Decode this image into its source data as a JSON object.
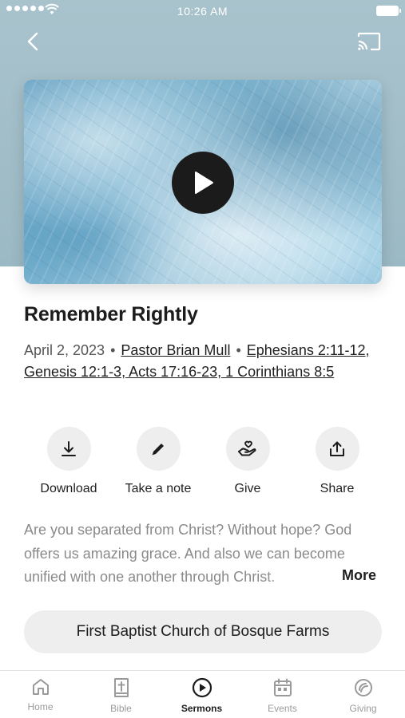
{
  "status_bar": {
    "time": "10:26 AM"
  },
  "sermon": {
    "title": "Remember Rightly",
    "date": "April 2, 2023",
    "speaker": "Pastor Brian Mull",
    "scripture": "Ephesians 2:11-12, Genesis 12:1-3, Acts 17:16-23, 1 Corinthians 8:5",
    "description": "Are you separated from Christ? Without hope? God offers us amazing grace. And also we can become unified with one another through Christ."
  },
  "actions": [
    {
      "label": "Download",
      "icon": "download-icon"
    },
    {
      "label": "Take a note",
      "icon": "pencil-icon"
    },
    {
      "label": "Give",
      "icon": "giving-hand-icon"
    },
    {
      "label": "Share",
      "icon": "share-icon"
    }
  ],
  "more_label": "More",
  "church_name": "First Baptist Church of Bosque Farms",
  "tabs": [
    {
      "label": "Home",
      "icon": "home-icon"
    },
    {
      "label": "Bible",
      "icon": "bible-icon"
    },
    {
      "label": "Sermons",
      "icon": "play-circle-icon"
    },
    {
      "label": "Events",
      "icon": "calendar-icon"
    },
    {
      "label": "Giving",
      "icon": "giving-icon"
    }
  ],
  "active_tab": "Sermons",
  "colors": {
    "hero_background": "#a9c3cd",
    "action_circle": "#eeeeee",
    "tab_inactive": "#9a9a9a",
    "tab_active": "#1c1c1c"
  }
}
